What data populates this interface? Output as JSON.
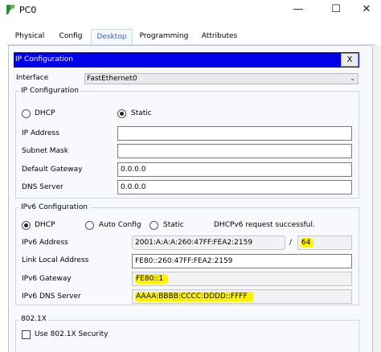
{
  "window": {
    "title": "PC0",
    "minimize": "—",
    "maximize": "☐",
    "close": "✕"
  },
  "tabs": [
    "Physical",
    "Config",
    "Desktop",
    "Programming",
    "Attributes"
  ],
  "ip_config": {
    "header": "IP Configuration",
    "close": "X",
    "interface_label": "Interface",
    "interface_value": "FastEthernet0",
    "ipv4": {
      "title": "IP Configuration",
      "dhcp_label": "DHCP",
      "static_label": "Static",
      "selected": "Static",
      "ip_address_label": "IP Address",
      "ip_address_value": "",
      "subnet_mask_label": "Subnet Mask",
      "subnet_mask_value": "",
      "gateway_label": "Default Gateway",
      "gateway_value": "0.0.0.0",
      "dns_label": "DNS Server",
      "dns_value": "0.0.0.0"
    },
    "ipv6": {
      "title": "IPv6 Configuration",
      "dhcp_label": "DHCP",
      "auto_label": "Auto Config",
      "static_label": "Static",
      "selected": "DHCP",
      "status": "DHCPv6 request successful.",
      "address_label": "IPv6 Address",
      "address_value": "2001:A:A:A:260:47FF:FEA2:2159",
      "slash": "/",
      "prefix_value": "64",
      "link_local_label": "Link Local Address",
      "link_local_value": "FE80::260:47FF:FEA2:2159",
      "gateway_label": "IPv6 Gateway",
      "gateway_value": "FE80::1",
      "dns_label": "IPv6 DNS Server",
      "dns_value": "AAAA:BBBB:CCCC:DDDD::FFFF"
    },
    "dot1x": {
      "title": "802.1X",
      "use_label": "Use 802.1X Security",
      "checked": false
    }
  }
}
